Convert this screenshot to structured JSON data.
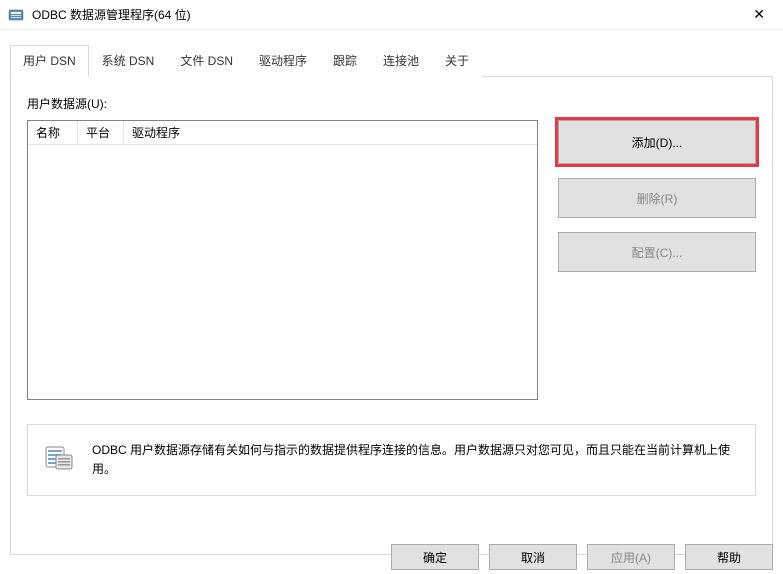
{
  "titlebar": {
    "title": "ODBC 数据源管理程序(64 位)"
  },
  "tabs": [
    {
      "label": "用户 DSN",
      "active": true
    },
    {
      "label": "系统 DSN",
      "active": false
    },
    {
      "label": "文件 DSN",
      "active": false
    },
    {
      "label": "驱动程序",
      "active": false
    },
    {
      "label": "跟踪",
      "active": false
    },
    {
      "label": "连接池",
      "active": false
    },
    {
      "label": "关于",
      "active": false
    }
  ],
  "panel": {
    "list_label": "用户数据源(U):",
    "columns": {
      "name": "名称",
      "platform": "平台",
      "driver": "驱动程序"
    },
    "buttons": {
      "add": "添加(D)...",
      "remove": "删除(R)",
      "configure": "配置(C)..."
    },
    "info": "ODBC 用户数据源存储有关如何与指示的数据提供程序连接的信息。用户数据源只对您可见，而且只能在当前计算机上使用。"
  },
  "footer": {
    "ok": "确定",
    "cancel": "取消",
    "apply": "应用(A)",
    "help": "帮助"
  }
}
